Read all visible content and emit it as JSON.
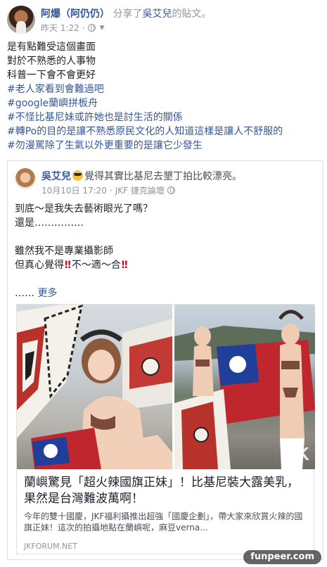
{
  "post": {
    "author": "阿爆（阿仍仍）",
    "action_prefix": "分享了",
    "shared_author": "吳艾兒",
    "action_suffix": "的貼文。",
    "timestamp": "昨天 1:22",
    "audience_icon": "globe-icon",
    "lines": [
      "是有點難受這個畫面",
      "對於不熟悉的人事物",
      "科普一下會不會更好"
    ],
    "hashtags": [
      "#老人家看到會難過吧",
      "#google蘭嶼拼板舟",
      "#不怪比基尼妹或許她也是討生活的關係",
      "#轉Po的目的是讓不熟悉原民文化的人知道這樣是讓人不舒服的",
      "#勿漫罵除了生氣以外更重要的是讓它少發生"
    ]
  },
  "shared": {
    "author": "吳艾兒",
    "feeling_icon": "sunglasses-emoji-icon",
    "feeling": "覺得其實比基尼去墾丁拍比較漂亮。",
    "date": "10月10日 17:20",
    "separator": "·",
    "group": "JKF 捷克論壇",
    "audience_icon": "globe-icon",
    "line1": "到底～是我失去藝術眼光了嗎？",
    "line2": "還是……………",
    "line3": "雖然我不是專業攝影師",
    "line4_prefix": "但真心覺得",
    "line4_bang": "‼",
    "line4_middle": "不～適～合",
    "line4_bang2": "‼",
    "ellipsis": "……",
    "more_label": "更多"
  },
  "link": {
    "title": "蘭嶼驚見「超火辣國旗正妹」！比基尼裝大露美乳，果然是台灣難波萬啊！",
    "description": "今年的雙十國慶，JKF福利攝推出超強「國慶企劃」，帶大家來欣賞火辣的國旗正妹！這次的拍攝地點在蘭嶼呢，麻豆verna...",
    "domain": "JKFORUM.NET",
    "photo_watermark": "JK"
  },
  "watermark": "funpeer.com",
  "colors": {
    "link_blue": "#365899",
    "meta_gray": "#90949c",
    "border": "#dddfe2",
    "bang_red": "#d0021b"
  }
}
